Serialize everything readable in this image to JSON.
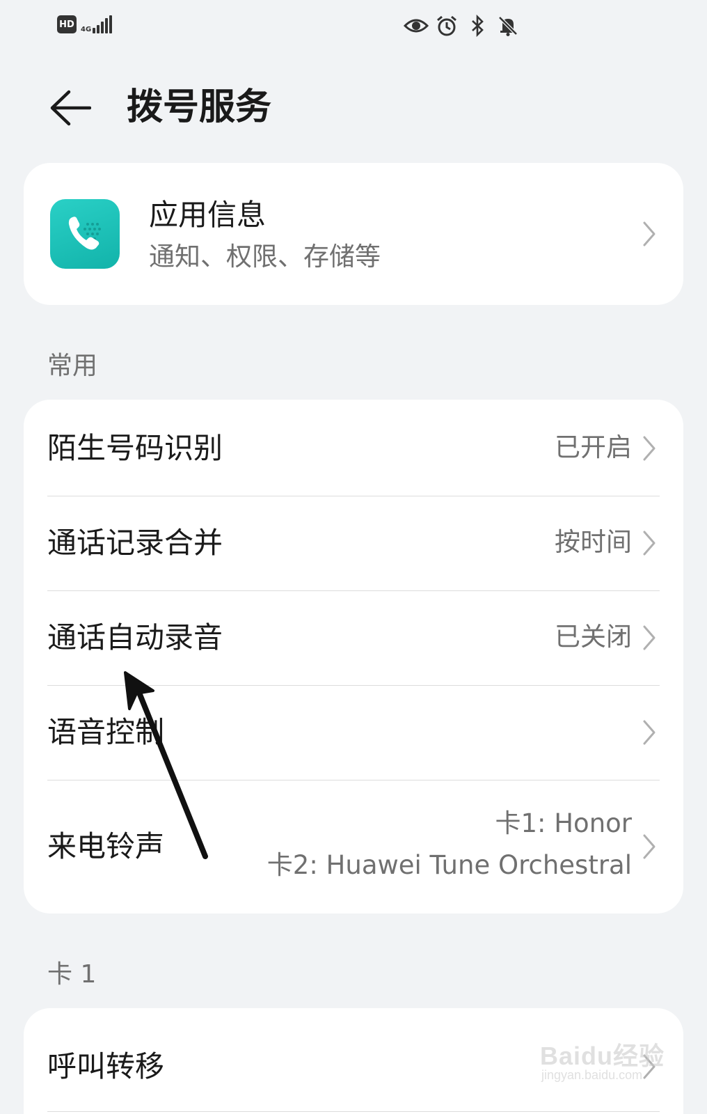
{
  "status_bar": {
    "hd_badge": "HD",
    "network": "4G",
    "icons": [
      "eye-icon",
      "alarm-icon",
      "bluetooth-icon",
      "bell-off-icon"
    ]
  },
  "header": {
    "title": "拨号服务"
  },
  "app_info": {
    "title": "应用信息",
    "subtitle": "通知、权限、存储等"
  },
  "sections": {
    "common": "常用",
    "card1": "卡 1"
  },
  "common_items": [
    {
      "label": "陌生号码识别",
      "value": "已开启"
    },
    {
      "label": "通话记录合并",
      "value": "按时间"
    },
    {
      "label": "通话自动录音",
      "value": "已关闭"
    },
    {
      "label": "语音控制",
      "value": ""
    },
    {
      "label": "来电铃声",
      "value_line1": "卡1: Honor",
      "value_line2": "卡2: Huawei Tune Orchestral"
    }
  ],
  "card1_items": [
    {
      "label": "呼叫转移"
    }
  ],
  "watermark": {
    "main": "Baidu经验",
    "sub": "jingyan.baidu.com"
  },
  "colors": {
    "background": "#f1f3f5",
    "card": "#ffffff",
    "app_icon": "#19bdb3",
    "secondary_text": "#707070"
  }
}
